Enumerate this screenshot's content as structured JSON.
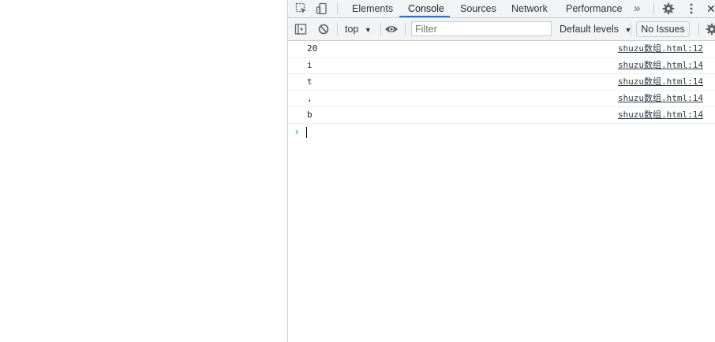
{
  "devtools": {
    "tabs": [
      "Elements",
      "Console",
      "Sources",
      "Network",
      "Performance"
    ],
    "active_tab": "Console",
    "more_tabs_glyph": "»",
    "close_glyph": "✕"
  },
  "toolbar": {
    "context": "top",
    "filter_placeholder": "Filter",
    "levels": "Default levels",
    "issues": "No Issues"
  },
  "console": {
    "messages": [
      {
        "text": "20",
        "source": "shuzu数组.html:12"
      },
      {
        "text": "i",
        "source": "shuzu数组.html:14"
      },
      {
        "text": "t",
        "source": "shuzu数组.html:14"
      },
      {
        "text": ",",
        "source": "shuzu数组.html:14"
      },
      {
        "text": "b",
        "source": "shuzu数组.html:14"
      }
    ],
    "prompt_glyph": "›"
  },
  "colors": {
    "accent": "#1a73e8",
    "chrome_bg": "#f1f3f4",
    "border": "#cacdd1"
  },
  "icons": [
    "inspect-element-icon",
    "device-toolbar-icon",
    "settings-gear-icon",
    "kebab-menu-icon",
    "close-icon",
    "sidebar-toggle-icon",
    "clear-console-icon",
    "eye-icon",
    "dropdown-arrow-icon"
  ]
}
